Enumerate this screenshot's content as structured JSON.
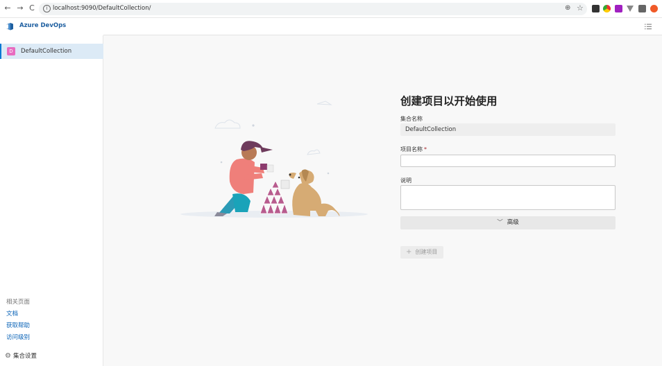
{
  "browser": {
    "url": "localhost:9090/DefaultCollection/",
    "back": "←",
    "forward": "→",
    "reload": "C",
    "info": "i",
    "zoom": "⊕",
    "star": "☆"
  },
  "header": {
    "brand": "Azure DevOps",
    "accent": "#0078d4"
  },
  "sidebar": {
    "collection": {
      "avatar": "D",
      "label": "DefaultCollection",
      "avatar_color": "#e86cc0"
    },
    "related_title": "相关页面",
    "links": [
      "文档",
      "获取帮助",
      "访问级别"
    ],
    "settings_label": "集合设置"
  },
  "form": {
    "title": "创建项目以开始使用",
    "collection_label": "集合名称",
    "collection_value": "DefaultCollection",
    "project_label": "项目名称",
    "required_mark": "*",
    "project_value": "",
    "description_label": "说明",
    "description_value": "",
    "advanced_label": "高级",
    "create_label": "创建项目"
  }
}
